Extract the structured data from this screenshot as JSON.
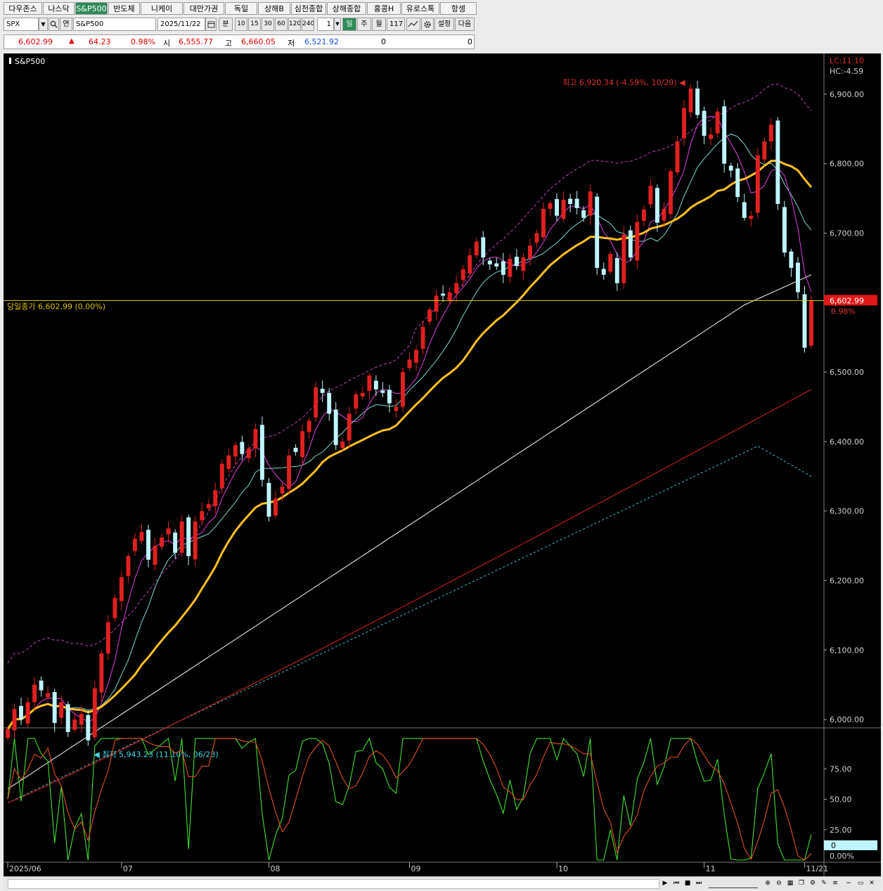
{
  "tabs": [
    {
      "label": "다우존스",
      "w": 55
    },
    {
      "label": "나스닥",
      "w": 45
    },
    {
      "label": "S&P500",
      "w": 46,
      "active": true
    },
    {
      "label": "반도체",
      "w": 45
    },
    {
      "label": "니케이",
      "w": 60
    },
    {
      "label": "대만가권",
      "w": 58
    },
    {
      "label": "독일",
      "w": 46
    },
    {
      "label": "상해B",
      "w": 46
    },
    {
      "label": "심천종합",
      "w": 50
    },
    {
      "label": "상해종합",
      "w": 56
    },
    {
      "label": "홍콩H",
      "w": 48
    },
    {
      "label": "유로스톡",
      "w": 54
    },
    {
      "label": "항셍",
      "w": 52
    }
  ],
  "toolbar": {
    "symbol": "SPX",
    "search_icon": "search-icon",
    "pin_label": "연",
    "name": "S&P500",
    "date": "2025/11/22",
    "calendar_icon": "calendar-icon",
    "unit": "분",
    "periods": [
      "10",
      "15",
      "30",
      "60",
      "120",
      "240"
    ],
    "multiplier": "1",
    "day": "일",
    "week": "주",
    "month": "월",
    "count": "117",
    "settings_label": "설정",
    "next_label": "다음"
  },
  "quote": {
    "price": "6,602.99",
    "arrow": "▲",
    "change": "64.23",
    "pct": "0.98%",
    "open_label": "시",
    "open": "6,555.77",
    "high_label": "고",
    "high": "6,660.05",
    "low_label": "저",
    "low": "6,521.92",
    "vol1": "0",
    "vol2": "0"
  },
  "chart_data": {
    "type": "candlestick",
    "title": "S&P500",
    "y_ticks": [
      "6,900.00",
      "6,800.00",
      "6,700.00",
      "6,600.00",
      "6,500.00",
      "6,400.00",
      "6,300.00",
      "6,200.00",
      "6,100.00",
      "6,000.00"
    ],
    "ylim": [
      5910,
      6935
    ],
    "x_labels": [
      {
        "text": "2025/06",
        "i": 0
      },
      {
        "text": "07",
        "i": 17
      },
      {
        "text": "08",
        "i": 39
      },
      {
        "text": "09",
        "i": 60
      },
      {
        "text": "10",
        "i": 82
      },
      {
        "text": "11",
        "i": 104
      },
      {
        "text": "11/21",
        "i": 119
      }
    ],
    "high_annotation": "최고 6,920.34 (-4.59%, 10/29)",
    "low_annotation": "최저 5,943.23 (11.10%, 06/23)",
    "close_line_label": "당일종가 6,602.99 (0.00%)",
    "right_labels": {
      "lc": "LC:11.10",
      "hc": "HC:-4.59",
      "price_tag": "6,602.99",
      "pct_tag": "0.98%"
    },
    "closes": [
      5986,
      6015,
      6000,
      6025,
      6050,
      6042,
      6038,
      5995,
      6025,
      5982,
      6000,
      6008,
      5970,
      6045,
      6095,
      6140,
      6175,
      6205,
      6235,
      6260,
      6270,
      6230,
      6250,
      6262,
      6275,
      6240,
      6285,
      6235,
      6285,
      6300,
      6310,
      6330,
      6368,
      6380,
      6395,
      6382,
      6390,
      6418,
      6345,
      6292,
      6318,
      6335,
      6380,
      6385,
      6415,
      6430,
      6478,
      6470,
      6440,
      6395,
      6400,
      6440,
      6468,
      6470,
      6495,
      6475,
      6470,
      6455,
      6450,
      6500,
      6518,
      6532,
      6565,
      6590,
      6610,
      6610,
      6615,
      6628,
      6648,
      6668,
      6688,
      6665,
      6655,
      6652,
      6640,
      6663,
      6653,
      6665,
      6682,
      6700,
      6735,
      6743,
      6725,
      6748,
      6742,
      6736,
      6722,
      6760,
      6650,
      6640,
      6670,
      6628,
      6698,
      6665,
      6716,
      6734,
      6768,
      6715,
      6735,
      6789,
      6832,
      6880,
      6908,
      6870,
      6840,
      6842,
      6875,
      6800,
      6790,
      6752,
      6722,
      6725,
      6812,
      6832,
      6856,
      6742,
      6672,
      6650,
      6615,
      6535,
      6603
    ],
    "upper_series_name": "",
    "stoch": {
      "y_ticks": [
        "75.00",
        "50.00",
        "25.00"
      ],
      "last_tag": "0",
      "bottom_label": "0.00%",
      "ylim": [
        0,
        100
      ]
    }
  },
  "bottom": {
    "controls": [
      "▶",
      "⏮",
      "■",
      "⏭"
    ]
  }
}
